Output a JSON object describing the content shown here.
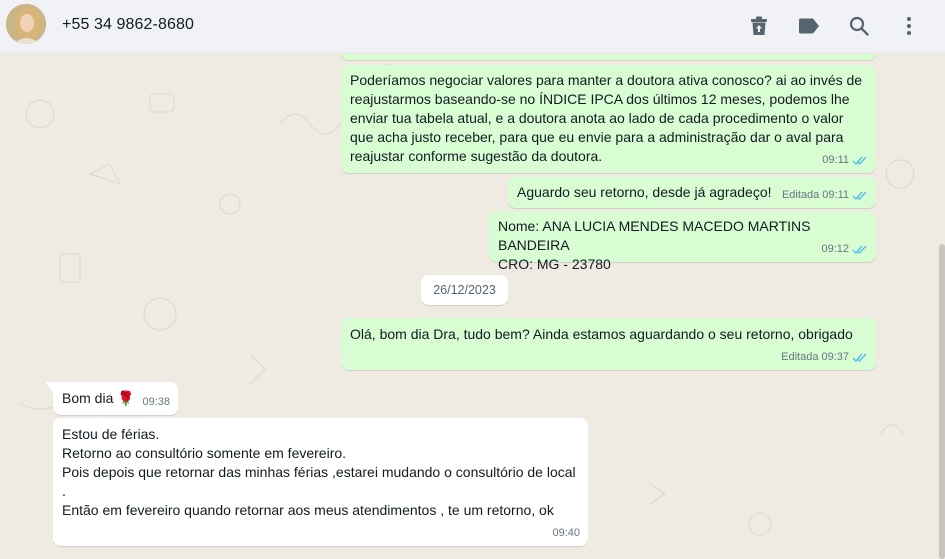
{
  "header": {
    "contact_name": "+55 34 9862-8680",
    "icons": [
      "archive-icon",
      "label-icon",
      "search-icon",
      "menu-icon"
    ]
  },
  "messages": [
    {
      "direction": "outgoing",
      "text": "Poderíamos negociar valores para manter a doutora ativa conosco? ai ao invés de reajustarmos baseando-se no ÍNDICE IPCA dos últimos 12 meses, podemos lhe enviar tua tabela atual, e a doutora anota ao lado de cada procedimento o valor que acha justo receber, para que eu envie para a administração dar o aval para reajustar conforme sugestão da doutora.",
      "time": "09:11",
      "edited": "",
      "status": "read"
    },
    {
      "direction": "outgoing",
      "text": "Aguardo seu retorno, desde já agradeço!",
      "time": "09:11",
      "edited": "Editada",
      "status": "read"
    },
    {
      "direction": "outgoing",
      "text": "Nome: ANA LUCIA MENDES MACEDO MARTINS BANDEIRA\nCRO: MG - 23780",
      "time": "09:12",
      "edited": "",
      "status": "read"
    },
    {
      "direction": "outgoing",
      "text": "Olá, bom dia Dra, tudo bem? Ainda estamos aguardando o seu retorno, obrigado",
      "time": "09:37",
      "edited": "Editada",
      "status": "read"
    },
    {
      "direction": "incoming",
      "text": "Bom dia 🌹",
      "time": "09:38",
      "edited": "",
      "status": ""
    },
    {
      "direction": "incoming",
      "text": "Estou de férias.\nRetorno ao consultório somente em fevereiro.\nPois depois que retornar das minhas férias ,estarei mudando o consultório de local\n.\nEntão em fevereiro quando retornar aos meus atendimentos , te um retorno, ok",
      "time": "09:40",
      "edited": "",
      "status": ""
    }
  ],
  "date_divider": "26/12/2023",
  "colors": {
    "outgoing_bubble": "#d9fdd3",
    "incoming_bubble": "#ffffff",
    "chat_background": "#efeae2",
    "header_background": "#f0f2f5",
    "read_ticks": "#53bdeb"
  }
}
